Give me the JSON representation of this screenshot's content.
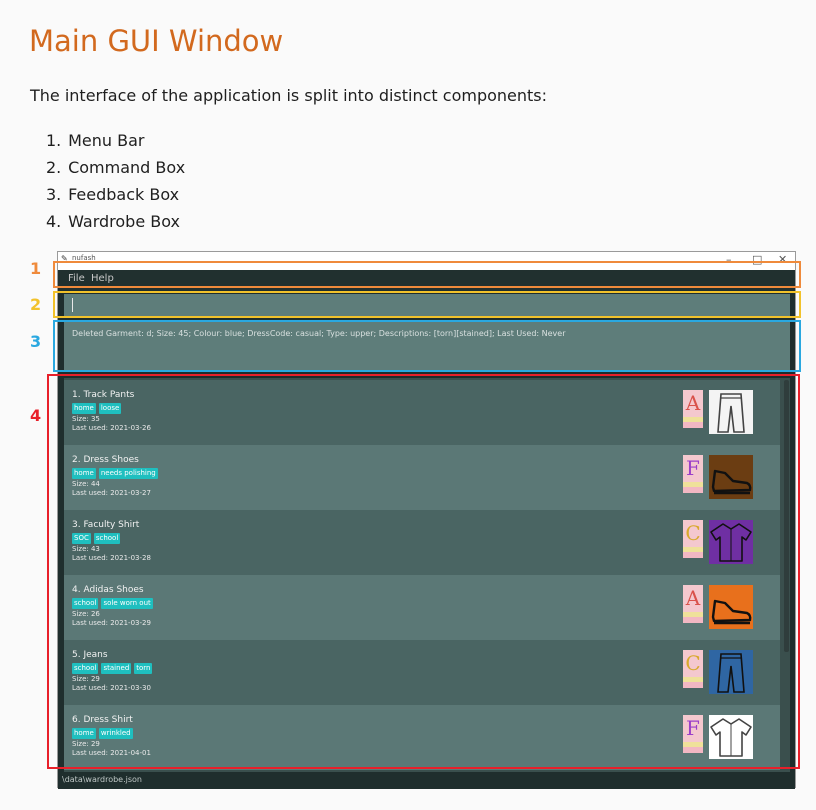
{
  "heading": "Main GUI Window",
  "intro": "The interface of the application is split into distinct components:",
  "components": [
    {
      "num": "1.",
      "label": "Menu Bar"
    },
    {
      "num": "2.",
      "label": "Command Box"
    },
    {
      "num": "3.",
      "label": "Feedback Box"
    },
    {
      "num": "4.",
      "label": "Wardrobe Box"
    }
  ],
  "annotations": [
    {
      "label": "1",
      "color": "#ef8a3b"
    },
    {
      "label": "2",
      "color": "#f2c22b"
    },
    {
      "label": "3",
      "color": "#2aa8e0"
    },
    {
      "label": "4",
      "color": "#e8202a"
    }
  ],
  "app": {
    "window_title": "nufash",
    "menu": [
      "File",
      "Help"
    ],
    "command_value": "",
    "feedback": "Deleted Garment: d; Size: 45; Colour: blue; DressCode: casual; Type: upper; Descriptions: [torn][stained]; Last Used: Never",
    "status": "\\data\\wardrobe.json",
    "garments": [
      {
        "index": "1.",
        "name": "Track Pants",
        "tags": [
          "home",
          "loose"
        ],
        "size": "Size: 35",
        "last_used": "Last used: 2021-03-26",
        "dresscode": "A",
        "dresscode_color": "#d9524b",
        "image": "pants-icon",
        "image_bg": "#f4f4f4"
      },
      {
        "index": "2.",
        "name": "Dress Shoes",
        "tags": [
          "home",
          "needs polishing"
        ],
        "size": "Size: 44",
        "last_used": "Last used: 2021-03-27",
        "dresscode": "F",
        "dresscode_color": "#9b3fc9",
        "image": "shoe-icon",
        "image_bg": "#6b3d12"
      },
      {
        "index": "3.",
        "name": "Faculty Shirt",
        "tags": [
          "SOC",
          "school"
        ],
        "size": "Size: 43",
        "last_used": "Last used: 2021-03-28",
        "dresscode": "C",
        "dresscode_color": "#d8a92c",
        "image": "shirt-icon",
        "image_bg": "#6f2fa3"
      },
      {
        "index": "4.",
        "name": "Adidas Shoes",
        "tags": [
          "school",
          "sole worn out"
        ],
        "size": "Size: 26",
        "last_used": "Last used: 2021-03-29",
        "dresscode": "A",
        "dresscode_color": "#d9524b",
        "image": "shoe-icon",
        "image_bg": "#e8701c"
      },
      {
        "index": "5.",
        "name": "Jeans",
        "tags": [
          "school",
          "stained",
          "torn"
        ],
        "size": "Size: 29",
        "last_used": "Last used: 2021-03-30",
        "dresscode": "C",
        "dresscode_color": "#d8a92c",
        "image": "pants-icon",
        "image_bg": "#2f66a3"
      },
      {
        "index": "6.",
        "name": "Dress Shirt",
        "tags": [
          "home",
          "wrinkled"
        ],
        "size": "Size: 29",
        "last_used": "Last used: 2021-04-01",
        "dresscode": "F",
        "dresscode_color": "#9b3fc9",
        "image": "shirt-icon",
        "image_bg": "#ffffff"
      }
    ]
  }
}
